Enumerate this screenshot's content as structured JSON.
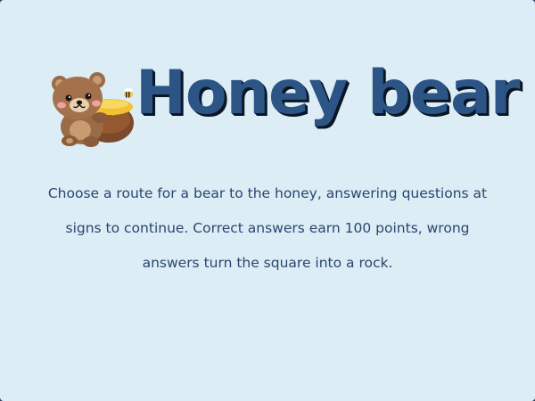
{
  "game": {
    "title": "Honey bear",
    "description": "Choose a route for a bear to the honey, answering questions at signs to continue. Correct answers earn 100 points, wrong answers turn the square into a rock."
  },
  "icons": {
    "mascot": "bear-with-honey-pot-icon",
    "bee": "bee-icon"
  },
  "colors": {
    "background": "#dcedf5",
    "title": "#2c5586",
    "title_shadow": "#0b1626",
    "text": "#2c4570",
    "bear_fur": "#9b6a47",
    "honey": "#f2c230",
    "pot": "#7b4a2c"
  }
}
